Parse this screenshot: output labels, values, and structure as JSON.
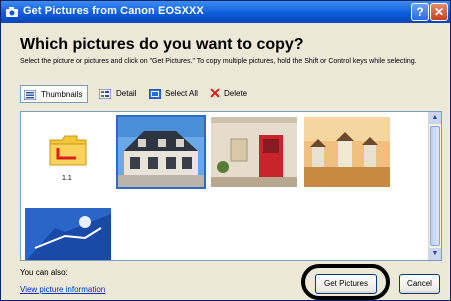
{
  "window": {
    "title": "Get Pictures from Canon EOSXXX",
    "help_label": "?",
    "close_label": "✕"
  },
  "heading": "Which pictures do you want to copy?",
  "instructions": "Select the picture or pictures and click on \"Get Pictures.\" To copy multiple pictures, hold the Shift or Control keys while selecting.",
  "toolbar": {
    "thumbnails": "Thumbnails",
    "detail": "Detail",
    "select_all": "Select All",
    "delete": "Delete"
  },
  "thumbnails": [
    {
      "type": "folder",
      "caption": "1.1"
    },
    {
      "type": "photo-house-sky",
      "selected": true
    },
    {
      "type": "photo-red-door"
    },
    {
      "type": "photo-windmills"
    },
    {
      "type": "photo-blue-sky"
    }
  ],
  "footer": {
    "you_can_also": "You can also:",
    "view_info_link": "View picture information"
  },
  "buttons": {
    "get_pictures": "Get Pictures",
    "cancel": "Cancel"
  },
  "colors": {
    "titlebar": "#0a5ad8",
    "selection": "#316ac5",
    "link": "#0033cc",
    "highlight_ring": "#000000"
  }
}
